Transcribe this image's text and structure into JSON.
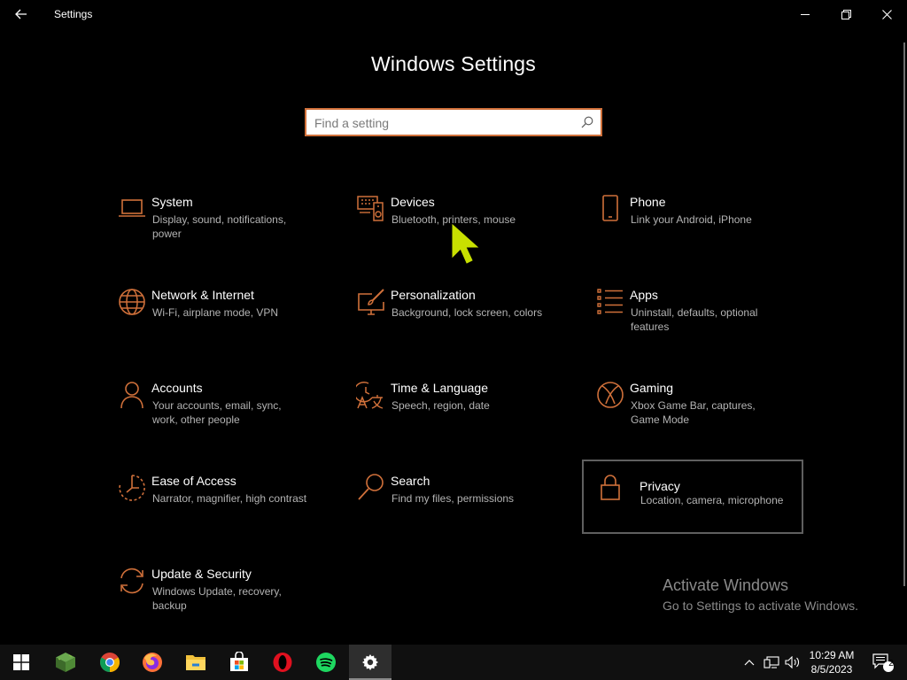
{
  "window": {
    "title": "Settings",
    "back_icon": "back-arrow-icon",
    "controls": [
      "minimize-icon",
      "restore-icon",
      "close-icon"
    ]
  },
  "header": {
    "title": "Windows Settings",
    "search_placeholder": "Find a setting",
    "search_value": ""
  },
  "accent_color": "#d0703a",
  "tiles": [
    {
      "name": "System",
      "desc": "Display, sound, notifications, power",
      "icon": "laptop-icon"
    },
    {
      "name": "Devices",
      "desc": "Bluetooth, printers, mouse",
      "icon": "keyboard-speaker-icon"
    },
    {
      "name": "Phone",
      "desc": "Link your Android, iPhone",
      "icon": "phone-icon"
    },
    {
      "name": "Network & Internet",
      "desc": "Wi-Fi, airplane mode, VPN",
      "icon": "globe-icon"
    },
    {
      "name": "Personalization",
      "desc": "Background, lock screen, colors",
      "icon": "paint-monitor-icon"
    },
    {
      "name": "Apps",
      "desc": "Uninstall, defaults, optional features",
      "icon": "apps-list-icon"
    },
    {
      "name": "Accounts",
      "desc": "Your accounts, email, sync, work, other people",
      "icon": "person-icon"
    },
    {
      "name": "Time & Language",
      "desc": "Speech, region, date",
      "icon": "time-language-icon"
    },
    {
      "name": "Gaming",
      "desc": "Xbox Game Bar, captures, Game Mode",
      "icon": "xbox-icon"
    },
    {
      "name": "Ease of Access",
      "desc": "Narrator, magnifier, high contrast",
      "icon": "ease-of-access-icon"
    },
    {
      "name": "Search",
      "desc": "Find my files, permissions",
      "icon": "magnifier-icon"
    },
    {
      "name": "Privacy",
      "desc": "Location, camera, microphone",
      "icon": "lock-icon",
      "selected": true
    },
    {
      "name": "Update & Security",
      "desc": "Windows Update, recovery, backup",
      "icon": "sync-arrows-icon"
    }
  ],
  "watermark": {
    "line1": "Activate Windows",
    "line2": "Go to Settings to activate Windows."
  },
  "taskbar": {
    "apps": [
      "windows-start-icon",
      "minecraft-icon",
      "chrome-icon",
      "firefox-icon",
      "file-explorer-icon",
      "microsoft-store-icon",
      "opera-icon",
      "spotify-icon",
      "settings-gear-icon"
    ],
    "active_app": "settings-gear-icon",
    "tray": [
      "chevron-up-icon",
      "network-icon",
      "volume-icon"
    ],
    "time": "10:29 AM",
    "date": "8/5/2023",
    "notifications_count": "2"
  }
}
